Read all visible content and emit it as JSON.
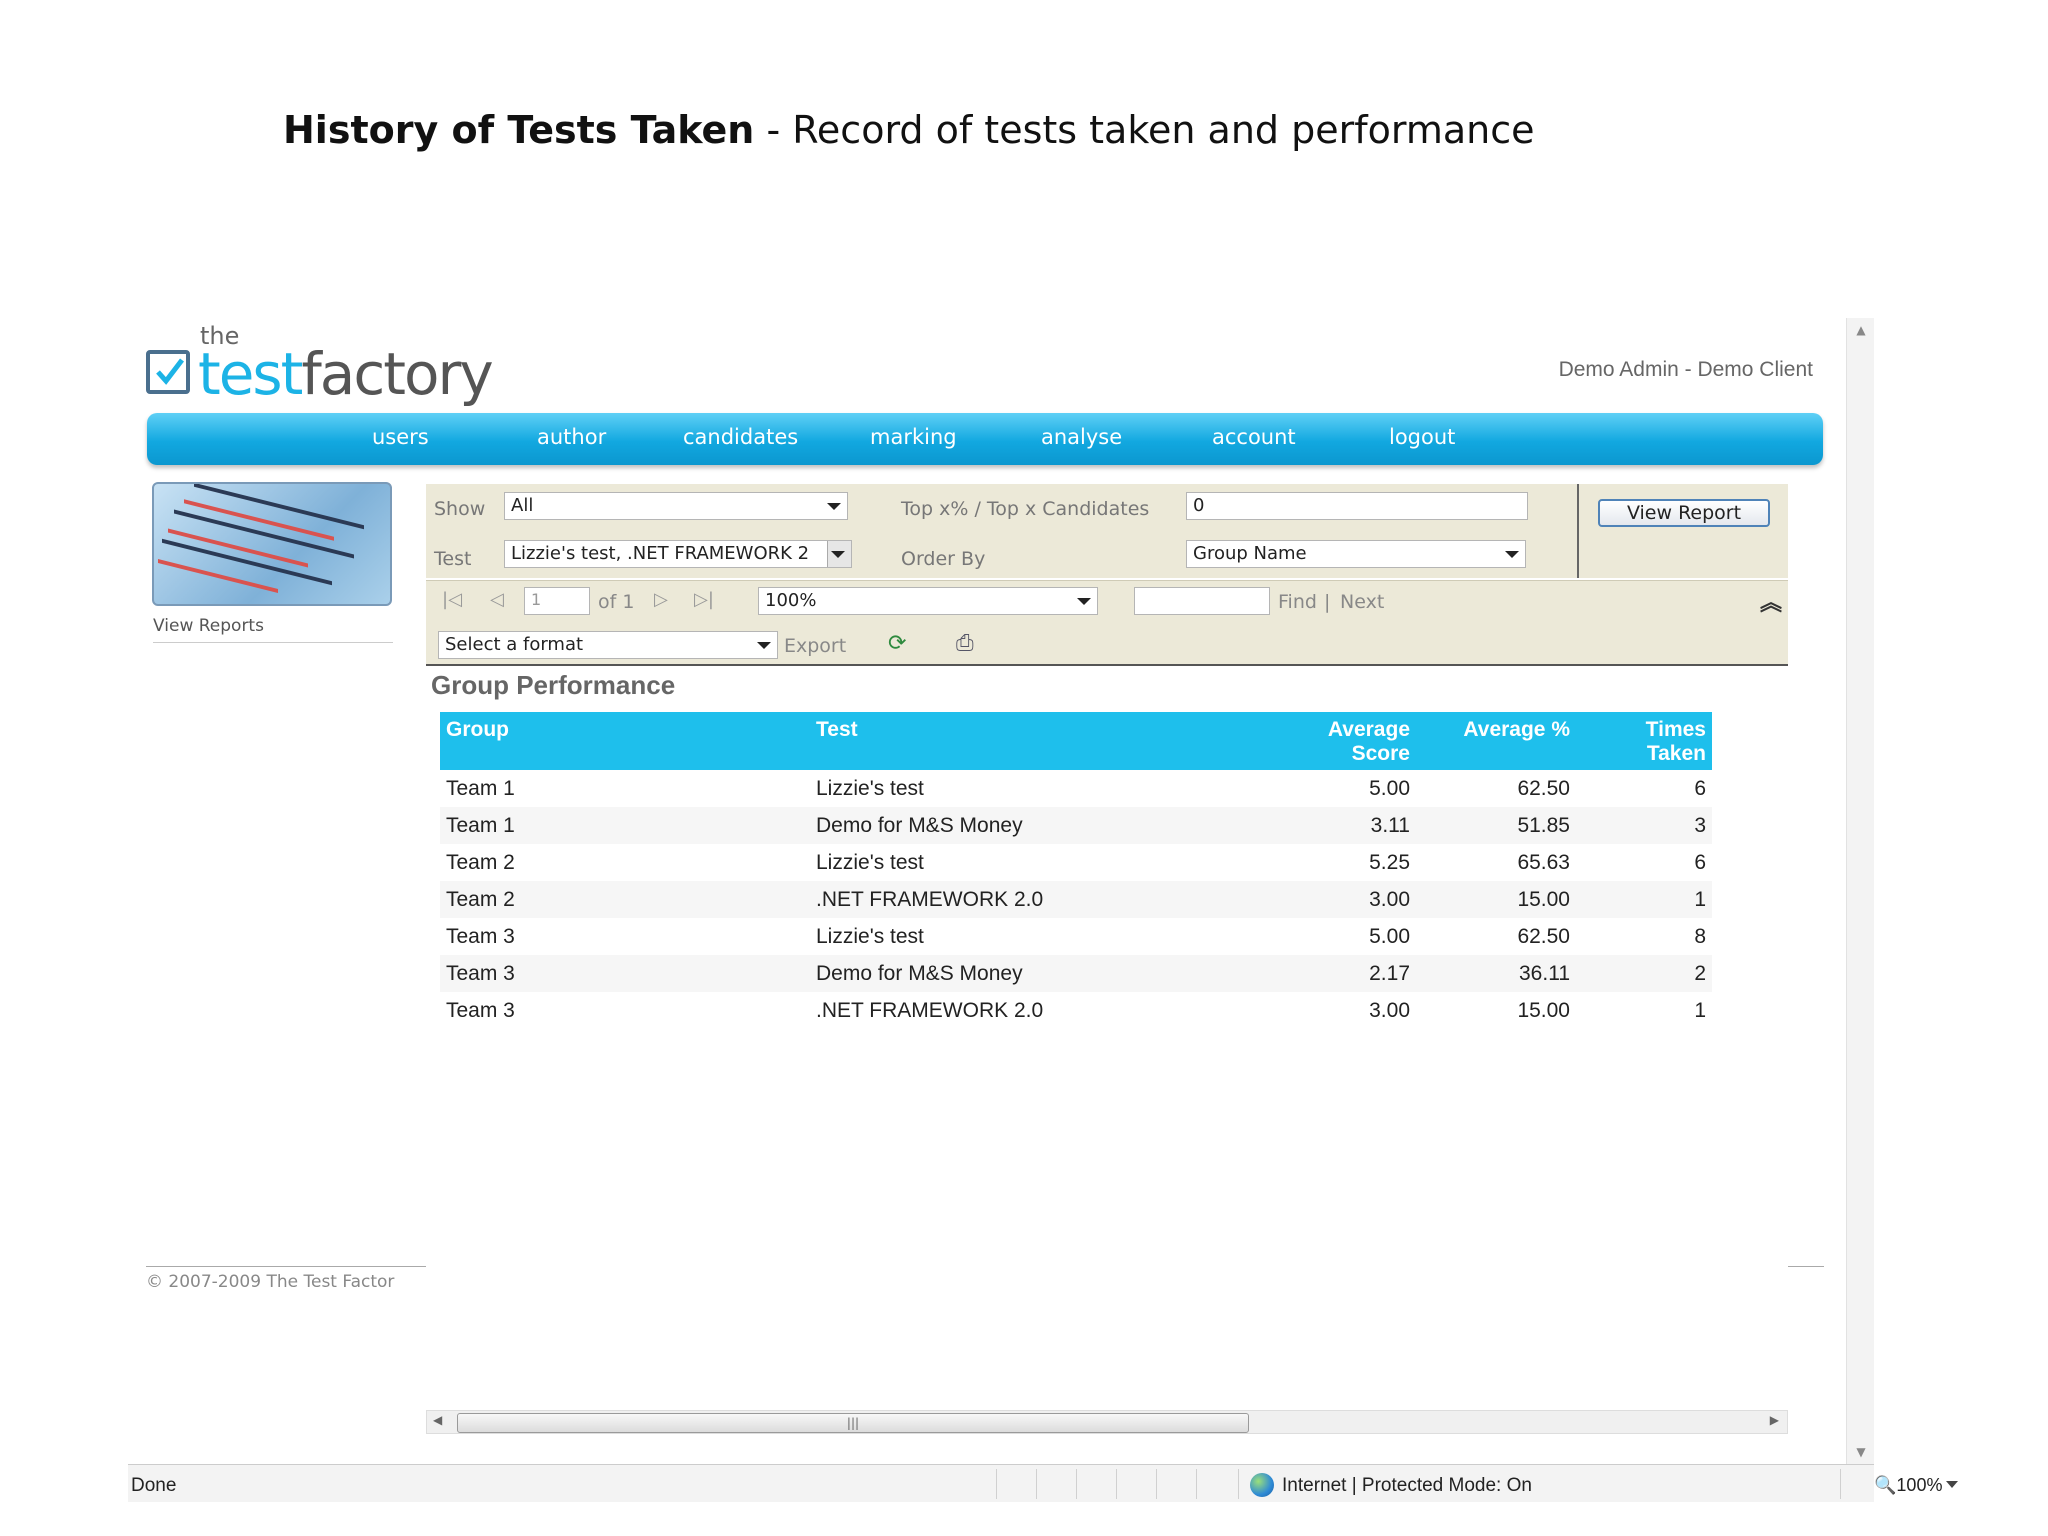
{
  "slide": {
    "title_bold": "History of Tests Taken",
    "title_rest": " - Record of tests taken and performance"
  },
  "brand": {
    "the": "the",
    "word_a": "test",
    "word_b": "factory"
  },
  "header": {
    "user_info": "Demo Admin - Demo Client"
  },
  "nav": {
    "users": "users",
    "author": "author",
    "candidates": "candidates",
    "marking": "marking",
    "analyse": "analyse",
    "account": "account",
    "logout": "logout"
  },
  "sidebar": {
    "view_reports": "View Reports"
  },
  "params": {
    "show_label": "Show",
    "show_value": "All",
    "test_label": "Test",
    "test_value": "Lizzie's test, .NET FRAMEWORK 2",
    "top_label": "Top x% / Top x Candidates",
    "top_value": "0",
    "order_label": "Order By",
    "order_value": "Group Name",
    "view_report": "View Report"
  },
  "toolbar": {
    "page_value": "1",
    "of_pages": "of 1",
    "zoom_value": "100%",
    "find": "Find",
    "sep": "|",
    "next": "Next",
    "format_value": "Select a format",
    "export": "Export"
  },
  "report": {
    "title": "Group Performance",
    "headers": {
      "group": "Group",
      "test": "Test",
      "avg_score_1": "Average",
      "avg_score_2": "Score",
      "avg_pct": "Average %",
      "times_1": "Times",
      "times_2": "Taken"
    },
    "rows": [
      {
        "group": "Team 1",
        "test": "Lizzie's test",
        "avg_score": "5.00",
        "avg_pct": "62.50",
        "times": "6"
      },
      {
        "group": "Team 1",
        "test": "Demo for M&S Money",
        "avg_score": "3.11",
        "avg_pct": "51.85",
        "times": "3"
      },
      {
        "group": "Team 2",
        "test": "Lizzie's test",
        "avg_score": "5.25",
        "avg_pct": "65.63",
        "times": "6"
      },
      {
        "group": "Team 2",
        "test": ".NET FRAMEWORK 2.0",
        "avg_score": "3.00",
        "avg_pct": "15.00",
        "times": "1"
      },
      {
        "group": "Team 3",
        "test": "Lizzie's test",
        "avg_score": "5.00",
        "avg_pct": "62.50",
        "times": "8"
      },
      {
        "group": "Team 3",
        "test": "Demo for M&S Money",
        "avg_score": "2.17",
        "avg_pct": "36.11",
        "times": "2"
      },
      {
        "group": "Team 3",
        "test": ".NET FRAMEWORK 2.0",
        "avg_score": "3.00",
        "avg_pct": "15.00",
        "times": "1"
      }
    ]
  },
  "footer": {
    "copyright": "© 2007-2009 The Test Factor"
  },
  "status": {
    "done": "Done",
    "zone": "Internet | Protected Mode: On",
    "zoom": "100%"
  },
  "colors": {
    "accent": "#1ebfec",
    "param_bg": "#ece9d8",
    "logo_blue": "#1cb3e6"
  },
  "icons": [
    "first-page-icon",
    "prev-page-icon",
    "next-page-icon",
    "last-page-icon",
    "collapse-icon",
    "refresh-icon",
    "print-icon",
    "globe-icon",
    "zoom-icon"
  ]
}
